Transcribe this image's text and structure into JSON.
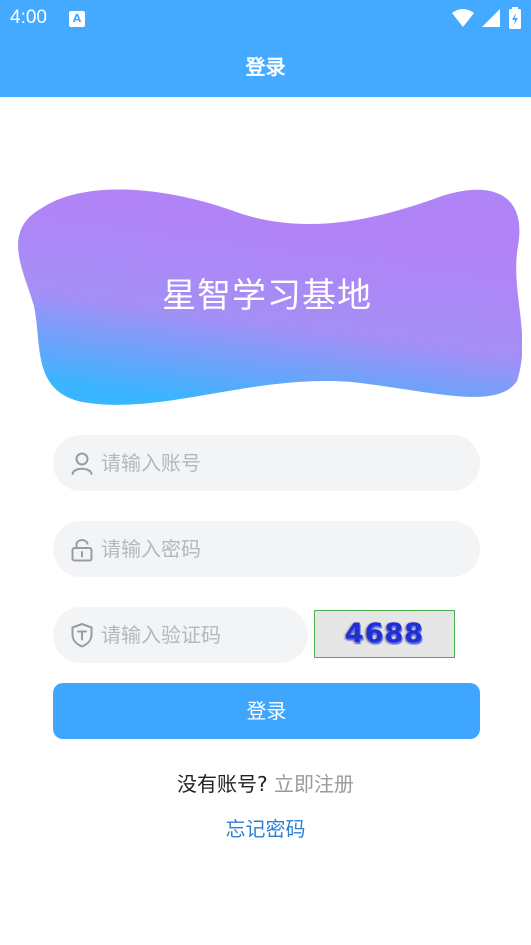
{
  "status_bar": {
    "time": "4:00",
    "notification_icon_letter": "A",
    "icons": [
      "wifi-icon",
      "signal-icon",
      "battery-icon"
    ]
  },
  "app_bar": {
    "title": "登录"
  },
  "banner": {
    "title": "星智学习基地",
    "gradient_colors": [
      "#b084f7",
      "#a98bf5",
      "#3fb4ff"
    ]
  },
  "form": {
    "account": {
      "placeholder": "请输入账号",
      "value": "",
      "icon": "user-icon"
    },
    "password": {
      "placeholder": "请输入密码",
      "value": "",
      "icon": "lock-icon"
    },
    "captcha": {
      "placeholder": "请输入验证码",
      "value": "",
      "icon": "shield-icon",
      "image_text": "4688"
    },
    "login_button": "登录"
  },
  "links": {
    "register_prompt": "没有账号?",
    "register_link": "立即注册",
    "forgot_password": "忘记密码"
  },
  "colors": {
    "primary": "#44aaff",
    "button": "#3ea6ff",
    "input_bg": "#f3f4f6",
    "placeholder": "#b4b7bc",
    "forgot_link": "#2c7fd6"
  }
}
